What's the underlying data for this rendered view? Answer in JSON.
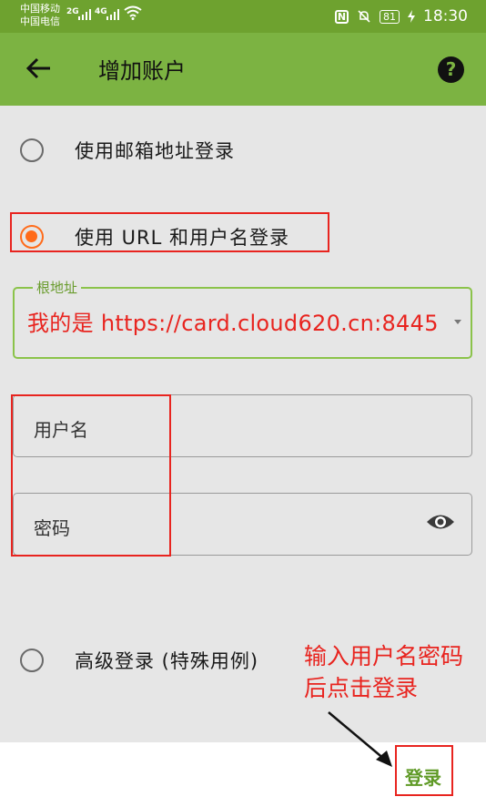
{
  "status_bar": {
    "carrier_1": "中国移动",
    "carrier_2": "中国电信",
    "net_1": "2G",
    "net_2": "4G",
    "nfc": "N",
    "battery": "81",
    "time": "18:30"
  },
  "app_bar": {
    "title": "增加账户",
    "back_icon": "arrow-left-icon",
    "help_label": "?"
  },
  "login_options": [
    {
      "label": "使用邮箱地址登录",
      "selected": false
    },
    {
      "label": "使用 URL 和用户名登录",
      "selected": true
    },
    {
      "label": "高级登录 (特殊用例)",
      "selected": false
    }
  ],
  "form": {
    "root_url_label": "根地址",
    "root_url_value": "我的是 https://card.cloud620.cn:8445",
    "username_placeholder": "用户名",
    "password_placeholder": "密码"
  },
  "annotation": {
    "line_1": "输入用户名密码",
    "line_2": "后点击登录"
  },
  "footer": {
    "login_button": "登录"
  },
  "colors": {
    "accent": "#7cb342",
    "status_bar": "#6ea22f",
    "radio_selected": "#ff6b1a",
    "annotation_red": "#e8241f"
  }
}
